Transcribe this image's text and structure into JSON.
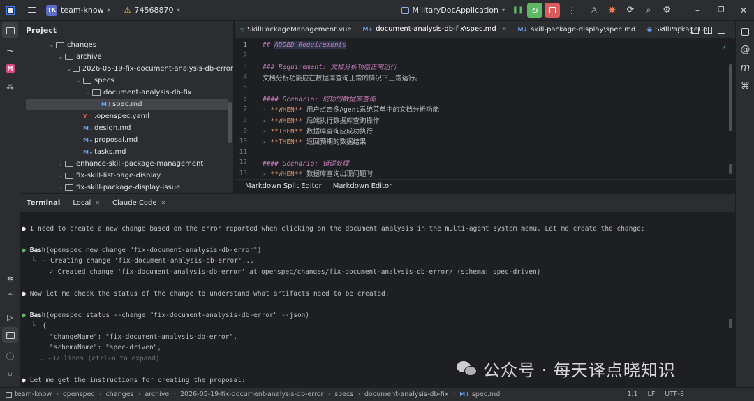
{
  "titlebar": {
    "project_initials": "TK",
    "project_name": "team-know",
    "warning_count": "74568870",
    "run_config": "MilitaryDocApplication"
  },
  "project_panel": {
    "title": "Project",
    "tree": [
      {
        "label": "changes",
        "type": "folder",
        "indent": 3,
        "expanded": true
      },
      {
        "label": "archive",
        "type": "folder",
        "indent": 4,
        "expanded": true
      },
      {
        "label": "2026-05-19-fix-document-analysis-db-error",
        "type": "folder",
        "indent": 5,
        "expanded": true
      },
      {
        "label": "specs",
        "type": "folder",
        "indent": 6,
        "expanded": true
      },
      {
        "label": "document-analysis-db-fix",
        "type": "folder",
        "indent": 7,
        "expanded": true
      },
      {
        "label": "spec.md",
        "type": "md",
        "indent": 8,
        "selected": true
      },
      {
        "label": ".openspec.yaml",
        "type": "yaml",
        "indent": 6
      },
      {
        "label": "design.md",
        "type": "md",
        "indent": 6
      },
      {
        "label": "proposal.md",
        "type": "md",
        "indent": 6
      },
      {
        "label": "tasks.md",
        "type": "md",
        "indent": 6
      },
      {
        "label": "enhance-skill-package-management",
        "type": "folder",
        "indent": 4,
        "expanded": false
      },
      {
        "label": "fix-skill-list-page-display",
        "type": "folder",
        "indent": 4,
        "expanded": false
      },
      {
        "label": "fix-skill-package-display-issue",
        "type": "folder",
        "indent": 4,
        "expanded": false
      }
    ]
  },
  "editor": {
    "tabs": [
      {
        "label": "SkillPackageManagement.vue",
        "active": false,
        "icon": "vue"
      },
      {
        "label": "document-analysis-db-fix\\spec.md",
        "active": true,
        "icon": "md"
      },
      {
        "label": "skill-package-display\\spec.md",
        "active": false,
        "icon": "md"
      },
      {
        "label": "SkillPackageCo",
        "active": false,
        "icon": "class"
      }
    ],
    "lines": [
      {
        "n": "1",
        "parts": [
          [
            "h",
            "## "
          ],
          [
            "h",
            "ADDED Requirements"
          ]
        ]
      },
      {
        "n": "2",
        "parts": []
      },
      {
        "n": "3",
        "parts": [
          [
            "h",
            "### Requirement: 文档分析功能正常运行"
          ]
        ]
      },
      {
        "n": "4",
        "parts": [
          [
            "w",
            "文档分析功能应在数据库查询正常的情况下正常运行。"
          ]
        ]
      },
      {
        "n": "5",
        "parts": []
      },
      {
        "n": "6",
        "parts": [
          [
            "h",
            "#### Scenario: 成功的数据库查询"
          ]
        ]
      },
      {
        "n": "7",
        "parts": [
          [
            "w",
            "- "
          ],
          [
            "b",
            "**WHEN**"
          ],
          [
            "w",
            " 用户点击多Agent系统菜单中的文档分析功能"
          ]
        ]
      },
      {
        "n": "8",
        "parts": [
          [
            "w",
            "- "
          ],
          [
            "b",
            "**WHEN**"
          ],
          [
            "w",
            " 后端执行数据库查询操作"
          ]
        ]
      },
      {
        "n": "9",
        "parts": [
          [
            "w",
            "- "
          ],
          [
            "b",
            "**THEN**"
          ],
          [
            "w",
            " 数据库查询应成功执行"
          ]
        ]
      },
      {
        "n": "10",
        "parts": [
          [
            "w",
            "- "
          ],
          [
            "b",
            "**THEN**"
          ],
          [
            "w",
            " 返回预期的数据结果"
          ]
        ]
      },
      {
        "n": "11",
        "parts": []
      },
      {
        "n": "12",
        "parts": [
          [
            "h",
            "#### Scenario: 错误处理"
          ]
        ]
      },
      {
        "n": "13",
        "parts": [
          [
            "w",
            "- "
          ],
          [
            "b",
            "**WHEN**"
          ],
          [
            "w",
            " 数据库查询出现问题时"
          ]
        ]
      }
    ],
    "bottom_tabs": [
      "Markdown Split Editor",
      "Markdown Editor"
    ]
  },
  "terminal": {
    "tabs": [
      {
        "label": "Terminal",
        "bold": true,
        "closable": false
      },
      {
        "label": "Local",
        "bold": false,
        "closable": true
      },
      {
        "label": "Claude Code",
        "bold": false,
        "closable": true
      }
    ],
    "lines": [
      {
        "kind": "blank"
      },
      {
        "kind": "dot",
        "text": "I need to create a new change based on the error reported when clicking on the document analysis in the multi-agent system menu. Let me create the change:"
      },
      {
        "kind": "blank"
      },
      {
        "kind": "gdot",
        "cmd": "Bash",
        "text": "(openspec new change \"fix-document-analysis-db-error\")"
      },
      {
        "kind": "out1",
        "text": "- Creating change 'fix-document-analysis-db-error'..."
      },
      {
        "kind": "out2",
        "text": "✓ Created change 'fix-document-analysis-db-error' at openspec/changes/fix-document-analysis-db-error/ (schema: spec-driven)"
      },
      {
        "kind": "blank"
      },
      {
        "kind": "dot",
        "text": "Now let me check the status of the change to understand what artifacts need to be created:"
      },
      {
        "kind": "blank"
      },
      {
        "kind": "gdot",
        "cmd": "Bash",
        "text": "(openspec status --change \"fix-document-analysis-db-error\" --json)"
      },
      {
        "kind": "out1",
        "text": "{"
      },
      {
        "kind": "out3",
        "text": "\"changeName\": \"fix-document-analysis-db-error\","
      },
      {
        "kind": "out3",
        "text": "\"schemaName\": \"spec-driven\","
      },
      {
        "kind": "gray",
        "text": "… +37 lines (ctrl+o to expand)"
      },
      {
        "kind": "blank"
      },
      {
        "kind": "dot",
        "text": "Let me get the instructions for creating the proposal:"
      }
    ]
  },
  "statusbar": {
    "breadcrumbs": [
      "team-know",
      "openspec",
      "changes",
      "archive",
      "2026-05-19-fix-document-analysis-db-error",
      "specs",
      "document-analysis-db-fix",
      "spec.md"
    ],
    "position": "1:1",
    "line_ending": "LF",
    "encoding": "UTF-8"
  },
  "watermark": {
    "text": "公众号 · 每天译点晓知识"
  }
}
